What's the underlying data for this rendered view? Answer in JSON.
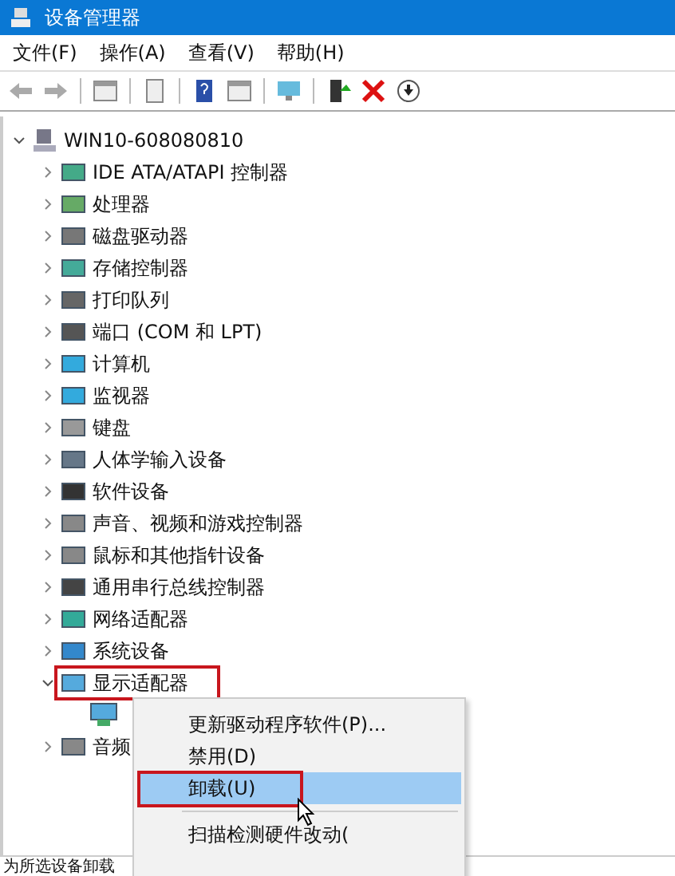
{
  "window": {
    "title": "设备管理器"
  },
  "menu_bar": [
    {
      "label": "文件(F)"
    },
    {
      "label": "操作(A)"
    },
    {
      "label": "查看(V)"
    },
    {
      "label": "帮助(H)"
    }
  ],
  "tree": {
    "label": "WIN10-608080810",
    "expanded": true,
    "highlighted": false,
    "children": [
      {
        "label": "IDE ATA/ATAPI 控制器",
        "expanded": false,
        "highlighted": false
      },
      {
        "label": "处理器",
        "expanded": false,
        "highlighted": false
      },
      {
        "label": "磁盘驱动器",
        "expanded": false,
        "highlighted": false
      },
      {
        "label": "存储控制器",
        "expanded": false,
        "highlighted": false
      },
      {
        "label": "打印队列",
        "expanded": false,
        "highlighted": false
      },
      {
        "label": "端口 (COM 和 LPT)",
        "expanded": false,
        "highlighted": false
      },
      {
        "label": "计算机",
        "expanded": false,
        "highlighted": false
      },
      {
        "label": "监视器",
        "expanded": false,
        "highlighted": false
      },
      {
        "label": "键盘",
        "expanded": false,
        "highlighted": false
      },
      {
        "label": "人体学输入设备",
        "expanded": false,
        "highlighted": false
      },
      {
        "label": "软件设备",
        "expanded": false,
        "highlighted": false
      },
      {
        "label": "声音、视频和游戏控制器",
        "expanded": false,
        "highlighted": false
      },
      {
        "label": "鼠标和其他指针设备",
        "expanded": false,
        "highlighted": false
      },
      {
        "label": "通用串行总线控制器",
        "expanded": false,
        "highlighted": false
      },
      {
        "label": "网络适配器",
        "expanded": false,
        "highlighted": false
      },
      {
        "label": "系统设备",
        "expanded": false,
        "highlighted": false
      },
      {
        "label": "显示适配器",
        "expanded": true,
        "highlighted": true,
        "children": [
          {
            "kind": "device"
          }
        ]
      },
      {
        "label": "音频",
        "expanded": false,
        "highlighted": false
      }
    ]
  },
  "context_menu": [
    {
      "kind": "item",
      "label": "更新驱动程序软件(P)...",
      "selected": false,
      "highlighted": false
    },
    {
      "kind": "item",
      "label": "禁用(D)",
      "selected": false,
      "highlighted": false
    },
    {
      "kind": "item",
      "label": "卸载(U)",
      "selected": true,
      "highlighted": true
    },
    {
      "kind": "separator"
    },
    {
      "kind": "item",
      "label": "扫描检测硬件改动(",
      "selected": false,
      "highlighted": false
    }
  ],
  "status_bar": "为所选设备卸载"
}
